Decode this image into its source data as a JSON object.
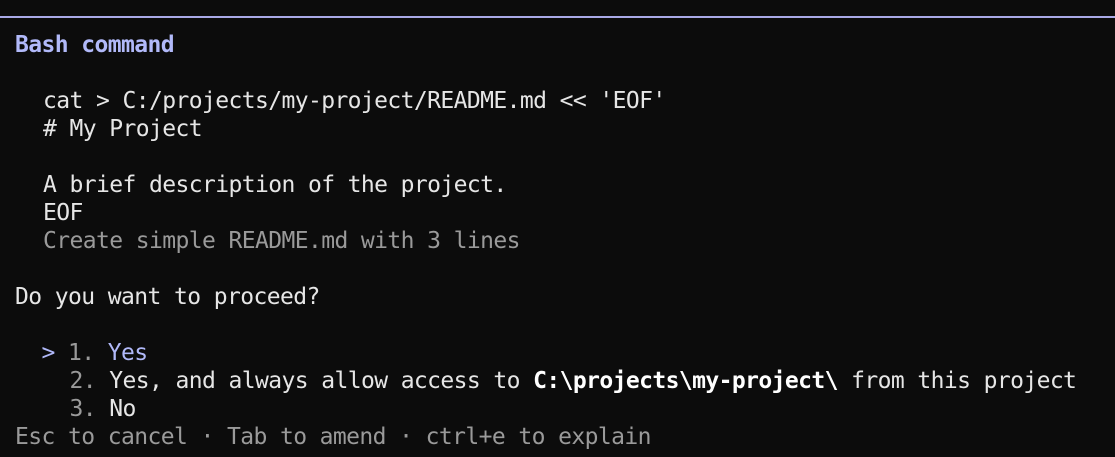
{
  "colors": {
    "background": "#0c0c0c",
    "border": "#a9a9e6",
    "accent": "#b1b9f9",
    "text": "#e6e6e6",
    "dim": "#9a9a9a"
  },
  "dialog": {
    "title": "Bash command",
    "command_lines": [
      "cat > C:/projects/my-project/README.md << 'EOF'",
      "# My Project",
      "",
      "A brief description of the project.",
      "EOF"
    ],
    "description": "Create simple README.md with 3 lines"
  },
  "prompt": {
    "question": "Do you want to proceed?",
    "cursor": ">",
    "options": [
      {
        "number": "1.",
        "label": "Yes"
      },
      {
        "number": "2.",
        "label_before": "Yes, and always allow access to ",
        "path": "C:\\projects\\my-project\\",
        "label_after": " from this project"
      },
      {
        "number": "3.",
        "label": "No"
      }
    ]
  },
  "footer": {
    "text": "Esc to cancel · Tab to amend · ctrl+e to explain"
  }
}
